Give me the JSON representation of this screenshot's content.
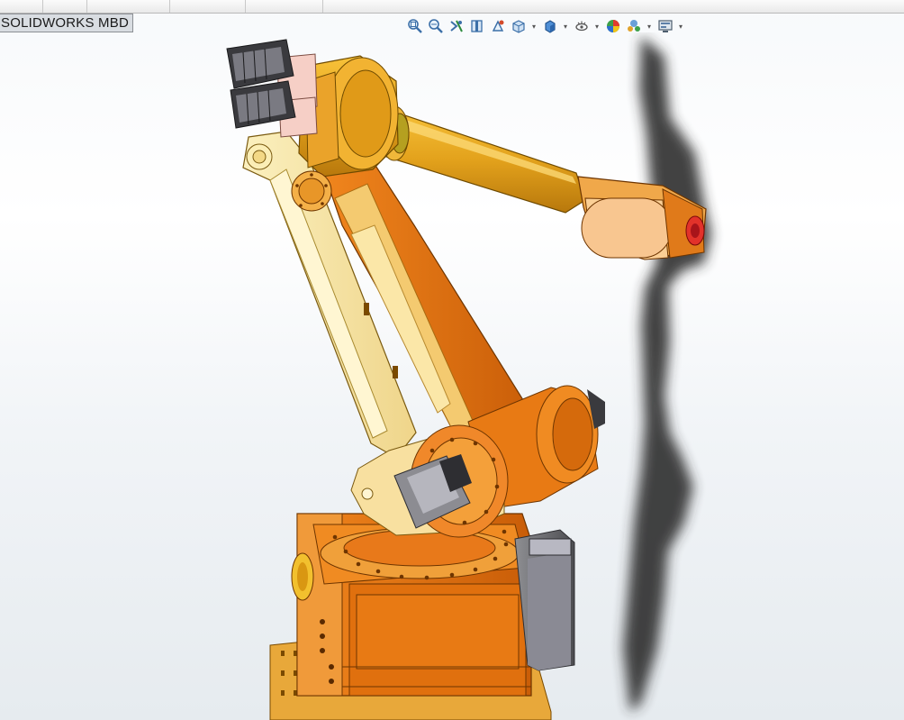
{
  "tab": {
    "label": "SOLIDWORKS MBD"
  },
  "heads_up_toolbar": {
    "buttons": [
      {
        "name": "zoom-to-fit-icon"
      },
      {
        "name": "zoom-to-area-icon"
      },
      {
        "name": "previous-view-icon"
      },
      {
        "name": "section-view-icon"
      },
      {
        "name": "dynamic-annotation-views-icon"
      },
      {
        "name": "view-orientation-icon",
        "dropdown": true
      },
      {
        "name": "display-style-icon",
        "dropdown": true
      },
      {
        "name": "hide-show-items-icon",
        "dropdown": true
      },
      {
        "name": "edit-appearance-icon"
      },
      {
        "name": "apply-scene-icon",
        "dropdown": true
      },
      {
        "name": "view-settings-icon",
        "dropdown": true
      }
    ]
  },
  "model": {
    "subject": "6-axis industrial robot arm",
    "colors": {
      "orange": "#e8730f",
      "gold": "#e6a21a",
      "cream": "#f8e7a6",
      "motor_gray": "#6d6d70",
      "shadow": "#3a3a3a",
      "red_tool": "#d6262a"
    }
  }
}
